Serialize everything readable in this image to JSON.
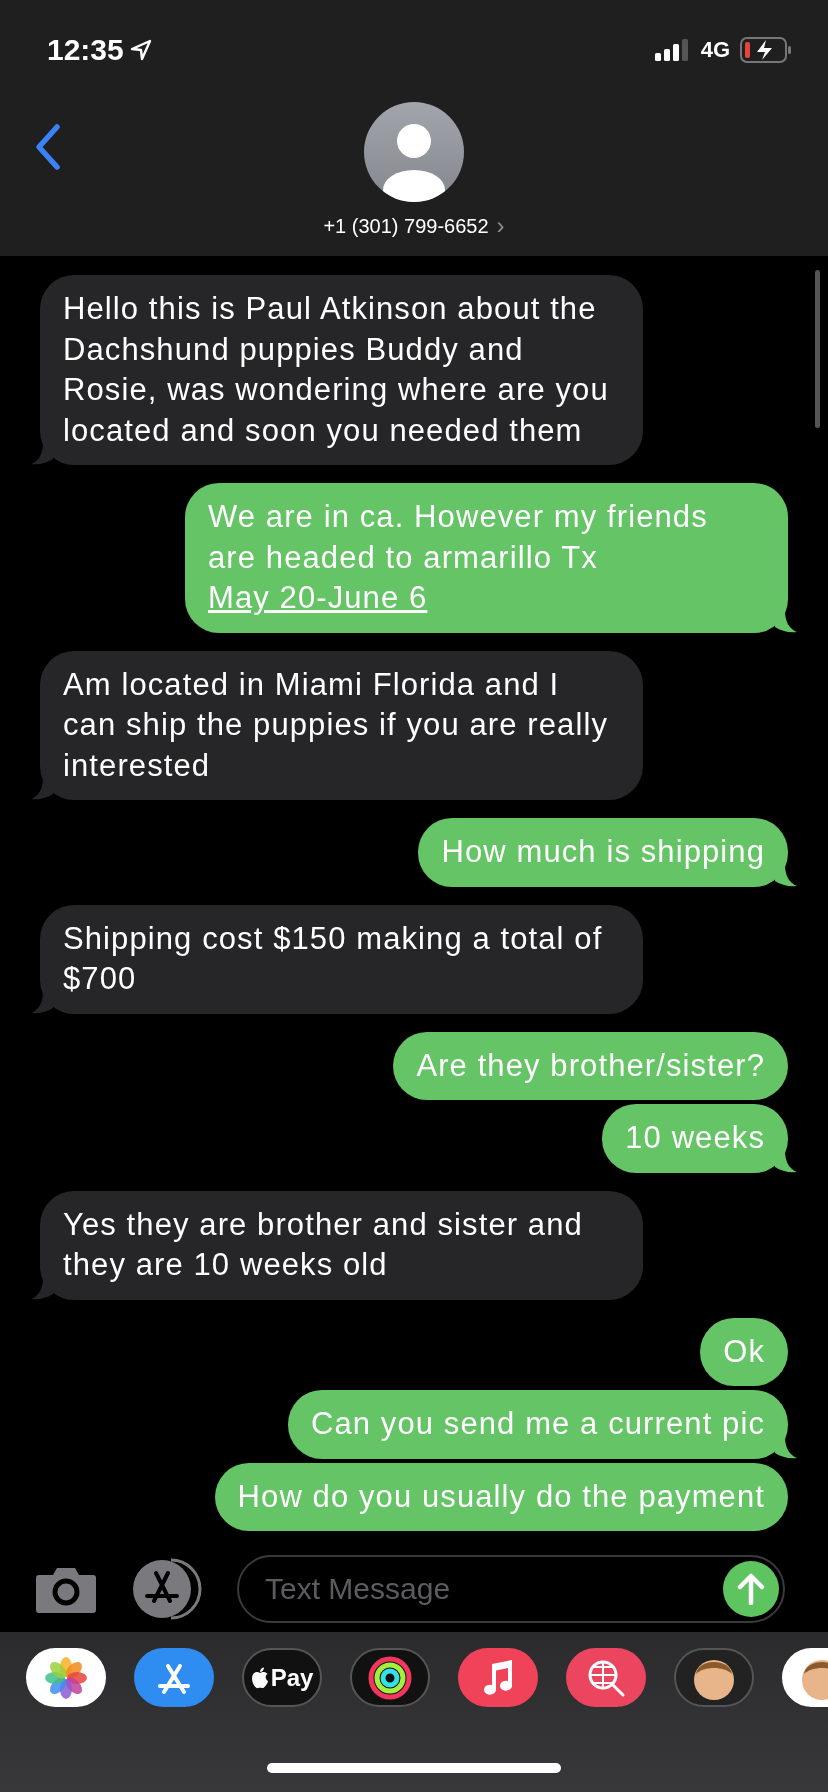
{
  "status_bar": {
    "time": "12:35",
    "network": "4G"
  },
  "contact": {
    "phone": "+1 (301) 799-6652",
    "chevron": "›"
  },
  "messages": [
    {
      "kind": "received",
      "text": "Hello this is Paul Atkinson about the Dachshund puppies Buddy and Rosie, was wondering where are you located and soon you needed them",
      "tail": true
    },
    {
      "kind": "sent",
      "text": "We are in ca. However my friends are headed to armarillo Tx",
      "link": "May 20-June 6",
      "tail": true
    },
    {
      "kind": "received",
      "text": "Am located in Miami Florida and I can ship the puppies if you are really interested",
      "tail": true
    },
    {
      "kind": "sent",
      "text": "How much is shipping",
      "tail": true
    },
    {
      "kind": "received",
      "text": "Shipping cost $150 making a total of $700",
      "tail": true
    },
    {
      "kind": "sent",
      "text": "Are they brother/sister?",
      "tail": false
    },
    {
      "kind": "sent",
      "text": "10 weeks",
      "tail": true
    },
    {
      "kind": "received",
      "text": "Yes they are brother and sister and they are 10 weeks old",
      "tail": true
    },
    {
      "kind": "sent",
      "text": "Ok",
      "tail": false
    },
    {
      "kind": "sent",
      "text": "Can you send me a current pic",
      "tail": true
    },
    {
      "kind": "sent",
      "text": "How do you usually do the payment",
      "tail": false
    }
  ],
  "composer": {
    "placeholder": "Text Message"
  },
  "app_tray": [
    {
      "kind": "photos"
    },
    {
      "kind": "appstore"
    },
    {
      "kind": "applepay",
      "label": "Pay"
    },
    {
      "kind": "activity"
    },
    {
      "kind": "music"
    },
    {
      "kind": "search"
    },
    {
      "kind": "memoji"
    },
    {
      "kind": "stickers"
    }
  ]
}
